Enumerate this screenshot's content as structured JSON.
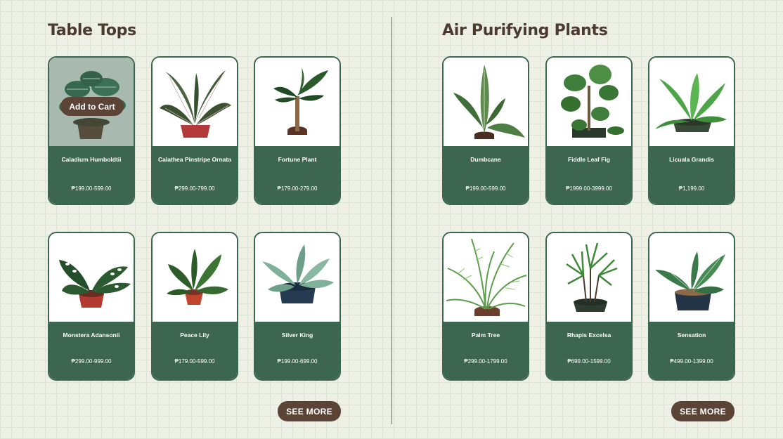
{
  "table_tops": {
    "title": "Table Tops",
    "see_more": "SEE MORE",
    "add_to_cart": "Add to Cart",
    "products": [
      {
        "name": "Caladium Humboldtii",
        "price": "₱199.00-599.00",
        "image": "caladium-plant-image"
      },
      {
        "name": "Calathea Pinstripe Ornata",
        "price": "₱299.00-799.00",
        "image": "calathea-plant-image"
      },
      {
        "name": "Fortune Plant",
        "price": "₱179.00-279.00",
        "image": "fortune-plant-image"
      },
      {
        "name": "Monstera Adansonii",
        "price": "₱299.00-999.00",
        "image": "monstera-plant-image"
      },
      {
        "name": "Peace Lily",
        "price": "₱179.00-599.00",
        "image": "peace-lily-image"
      },
      {
        "name": "Silver King",
        "price": "₱199.00-699.00",
        "image": "silver-king-image"
      }
    ]
  },
  "air_purifying": {
    "title": "Air Purifying Plants",
    "see_more": "SEE MORE",
    "products": [
      {
        "name": "Dumbcane",
        "price": "₱199.00-599.00",
        "image": "dumbcane-plant-image"
      },
      {
        "name": "Fiddle Leaf Fig",
        "price": "₱1999.00-3999.00",
        "image": "fiddle-leaf-fig-image"
      },
      {
        "name": "Licuala Grandis",
        "price": "₱1,199.00",
        "image": "licuala-plant-image"
      },
      {
        "name": "Palm Tree",
        "price": "₱299.00-1799.00",
        "image": "palm-tree-image"
      },
      {
        "name": "Rhapis Excelsa",
        "price": "₱699.00-1599.00",
        "image": "rhapis-plant-image"
      },
      {
        "name": "Sensation",
        "price": "₱499.00-1399.00",
        "image": "sensation-plant-image"
      }
    ]
  },
  "colors": {
    "background": "#eef0e6",
    "card_green": "#3d6650",
    "button_brown": "#5b4335",
    "heading_brown": "#4a3a30"
  }
}
